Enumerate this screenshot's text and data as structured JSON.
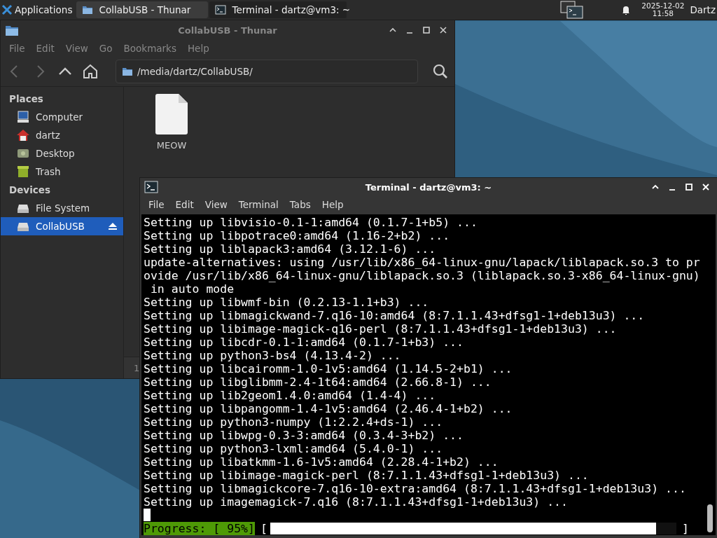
{
  "panel": {
    "apps_label": "Applications",
    "tasks": [
      {
        "title": "CollabUSB - Thunar",
        "kind": "folder",
        "selected": false
      },
      {
        "title": "Terminal - dartz@vm3: ~",
        "kind": "terminal",
        "selected": true
      }
    ],
    "clock_date": "2025-12-02",
    "clock_time": "11:58",
    "user": "Dartz"
  },
  "thunar": {
    "title": "CollabUSB - Thunar",
    "menu": [
      "File",
      "Edit",
      "View",
      "Go",
      "Bookmarks",
      "Help"
    ],
    "path": "/media/dartz/CollabUSB/",
    "sidebar": [
      {
        "heading": "Places",
        "items": [
          {
            "label": "Computer",
            "kind": "computer",
            "selected": false
          },
          {
            "label": "dartz",
            "kind": "home",
            "selected": false
          },
          {
            "label": "Desktop",
            "kind": "desktop",
            "selected": false
          },
          {
            "label": "Trash",
            "kind": "trash",
            "selected": false
          }
        ]
      },
      {
        "heading": "Devices",
        "items": [
          {
            "label": "File System",
            "kind": "drive",
            "selected": false
          },
          {
            "label": "CollabUSB",
            "kind": "drive",
            "selected": true,
            "eject": true
          }
        ]
      }
    ],
    "files": [
      {
        "name": "MEOW"
      }
    ],
    "status_bar": "1"
  },
  "terminal": {
    "title": "Terminal - dartz@vm3: ~",
    "menu": [
      "File",
      "Edit",
      "View",
      "Terminal",
      "Tabs",
      "Help"
    ],
    "lines": [
      "Setting up libvisio-0.1-1:amd64 (0.1.7-1+b5) ...",
      "Setting up libpotrace0:amd64 (1.16-2+b2) ...",
      "Setting up liblapack3:amd64 (3.12.1-6) ...",
      "update-alternatives: using /usr/lib/x86_64-linux-gnu/lapack/liblapack.so.3 to pr",
      "ovide /usr/lib/x86_64-linux-gnu/liblapack.so.3 (liblapack.so.3-x86_64-linux-gnu)",
      " in auto mode",
      "Setting up libwmf-bin (0.2.13-1.1+b3) ...",
      "Setting up libmagickwand-7.q16-10:amd64 (8:7.1.1.43+dfsg1-1+deb13u3) ...",
      "Setting up libimage-magick-q16-perl (8:7.1.1.43+dfsg1-1+deb13u3) ...",
      "Setting up libcdr-0.1-1:amd64 (0.1.7-1+b3) ...",
      "Setting up python3-bs4 (4.13.4-2) ...",
      "Setting up libcairomm-1.0-1v5:amd64 (1.14.5-2+b1) ...",
      "Setting up libglibmm-2.4-1t64:amd64 (2.66.8-1) ...",
      "Setting up lib2geom1.4.0:amd64 (1.4-4) ...",
      "Setting up libpangomm-1.4-1v5:amd64 (2.46.4-1+b2) ...",
      "Setting up python3-numpy (1:2.2.4+ds-1) ...",
      "Setting up libwpg-0.3-3:amd64 (0.3.4-3+b2) ...",
      "Setting up python3-lxml:amd64 (5.4.0-1) ...",
      "Setting up libatkmm-1.6-1v5:amd64 (2.28.4-1+b2) ...",
      "Setting up libimage-magick-perl (8:7.1.1.43+dfsg1-1+deb13u3) ...",
      "Setting up libmagickcore-7.q16-10-extra:amd64 (8:7.1.1.43+dfsg1-1+deb13u3) ...",
      "Setting up imagemagick-7.q16 (8:7.1.1.43+dfsg1-1+deb13u3) ..."
    ],
    "progress": {
      "label": "Progress: [ 95%]",
      "open": "[",
      "close": "]",
      "level": 0.95
    }
  }
}
